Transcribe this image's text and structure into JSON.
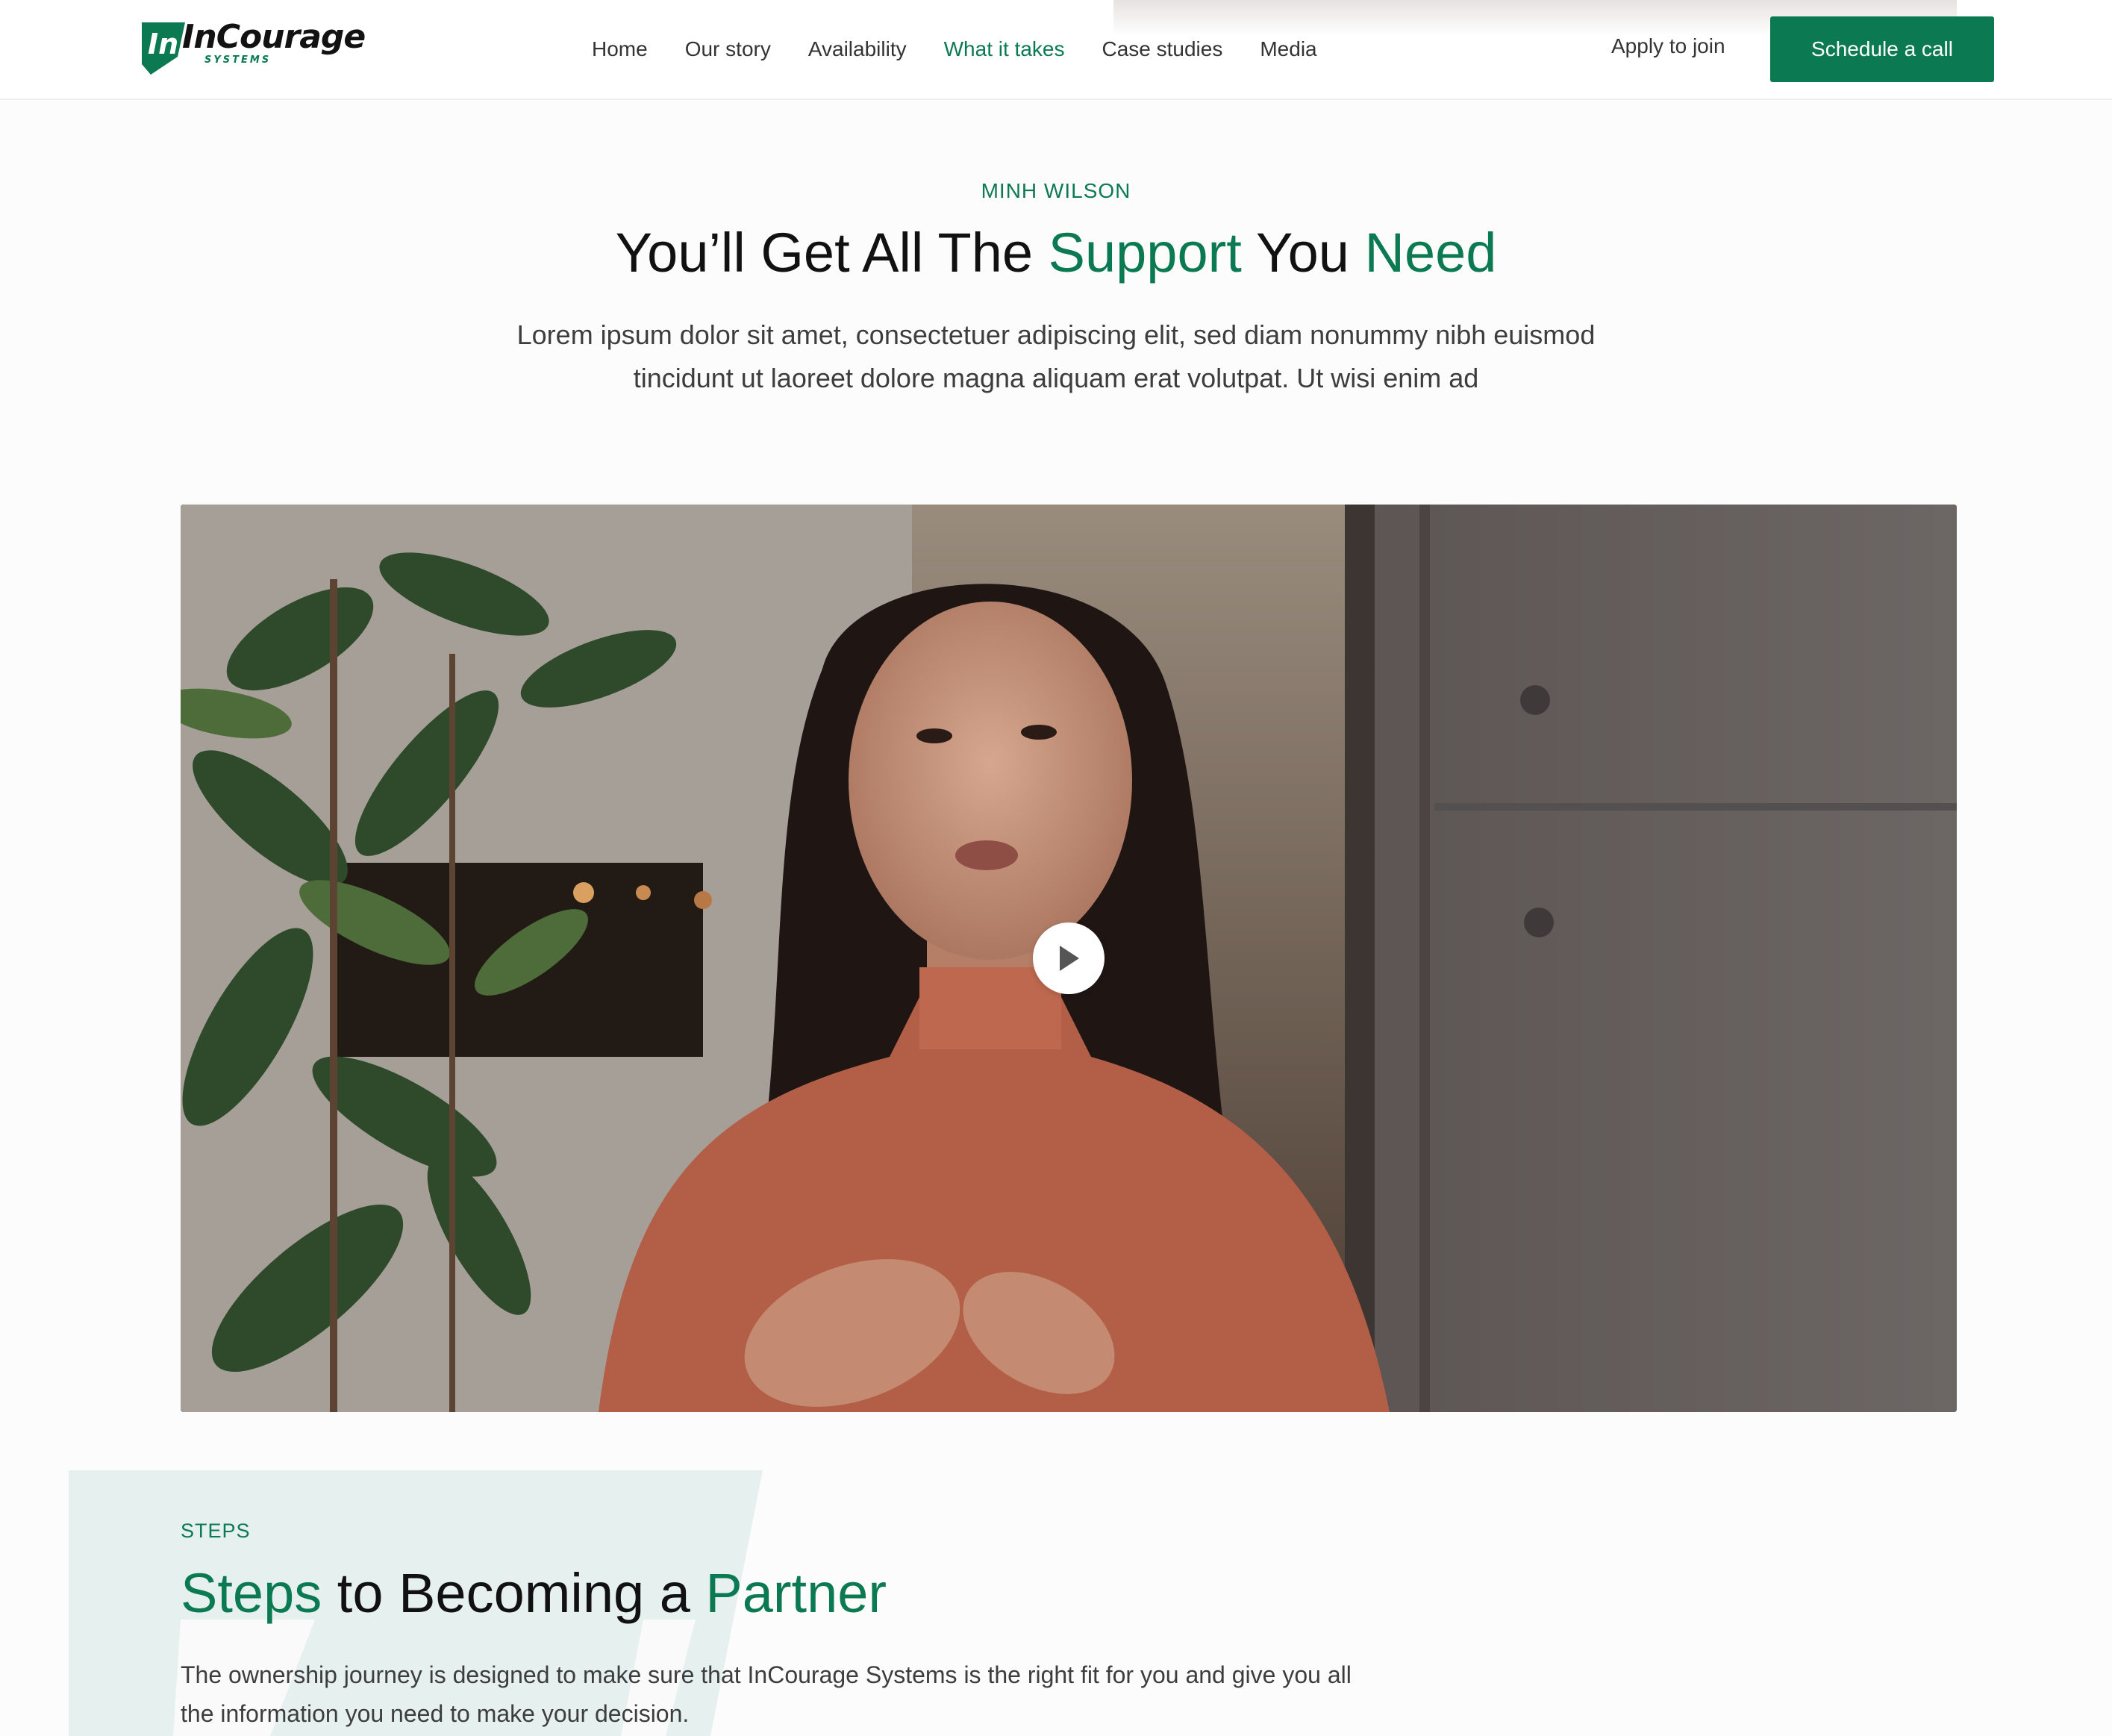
{
  "brand": {
    "name": "InCourage",
    "tagline": "SYSTEMS",
    "accent_color": "#0b7a52"
  },
  "nav": {
    "items": [
      {
        "label": "Home",
        "active": false
      },
      {
        "label": "Our story",
        "active": false
      },
      {
        "label": "Availability",
        "active": false
      },
      {
        "label": "What it takes",
        "active": true
      },
      {
        "label": "Case studies",
        "active": false
      },
      {
        "label": "Media",
        "active": false
      }
    ],
    "apply_label": "Apply to join",
    "cta_label": "Schedule a call"
  },
  "hero": {
    "eyebrow": "MINH WILSON",
    "title_parts": [
      "You’ll Get All The ",
      "Support",
      " You ",
      "Need"
    ],
    "body": "Lorem ipsum dolor sit amet, consectetuer adipiscing elit, sed diam nonummy nibh euismod tincidunt ut laoreet dolore magna aliquam erat volutpat. Ut wisi enim ad"
  },
  "video": {
    "play_icon": "play-icon"
  },
  "steps": {
    "eyebrow": "STEPS",
    "title_parts": [
      "Steps",
      " to Becoming a ",
      "Partner"
    ],
    "body": "The ownership journey is designed to make sure that InCourage Systems is the right fit for you and give you all the information you need to make your decision."
  }
}
